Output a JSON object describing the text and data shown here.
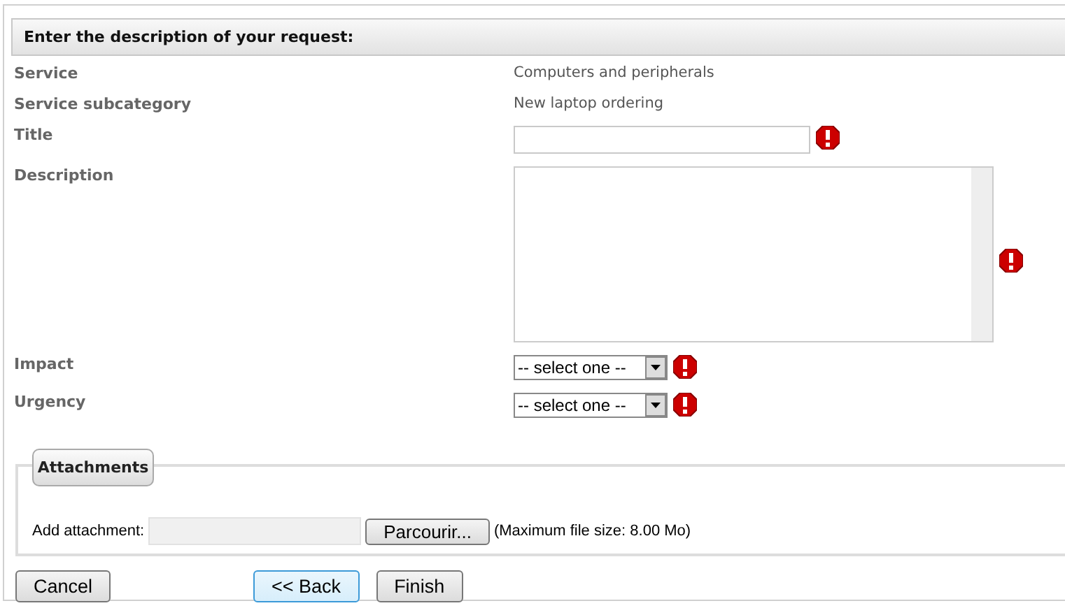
{
  "header": {
    "title": "Enter the description of your request:"
  },
  "fields": [
    {
      "kind": "text",
      "label": "Service",
      "value": "Computers and peripherals"
    },
    {
      "kind": "text",
      "label": "Service subcategory",
      "value": "New laptop ordering"
    },
    {
      "kind": "input",
      "label": "Title",
      "required": true
    },
    {
      "kind": "textarea",
      "label": "Description",
      "required": true
    },
    {
      "kind": "select",
      "label": "Impact",
      "value": "-- select one --",
      "required": true
    },
    {
      "kind": "select",
      "label": "Urgency",
      "value": "-- select one --",
      "required": true
    }
  ],
  "attachments": {
    "legend": "Attachments",
    "label": "Add attachment:",
    "browse": "Parcourir...",
    "note": "(Maximum file size: 8.00 Mo)"
  },
  "buttons": [
    {
      "kind": "cancel",
      "label": "Cancel",
      "focused": false
    },
    {
      "kind": "back",
      "label": "<< Back",
      "focused": true
    },
    {
      "kind": "finish",
      "label": "Finish",
      "focused": false
    }
  ]
}
